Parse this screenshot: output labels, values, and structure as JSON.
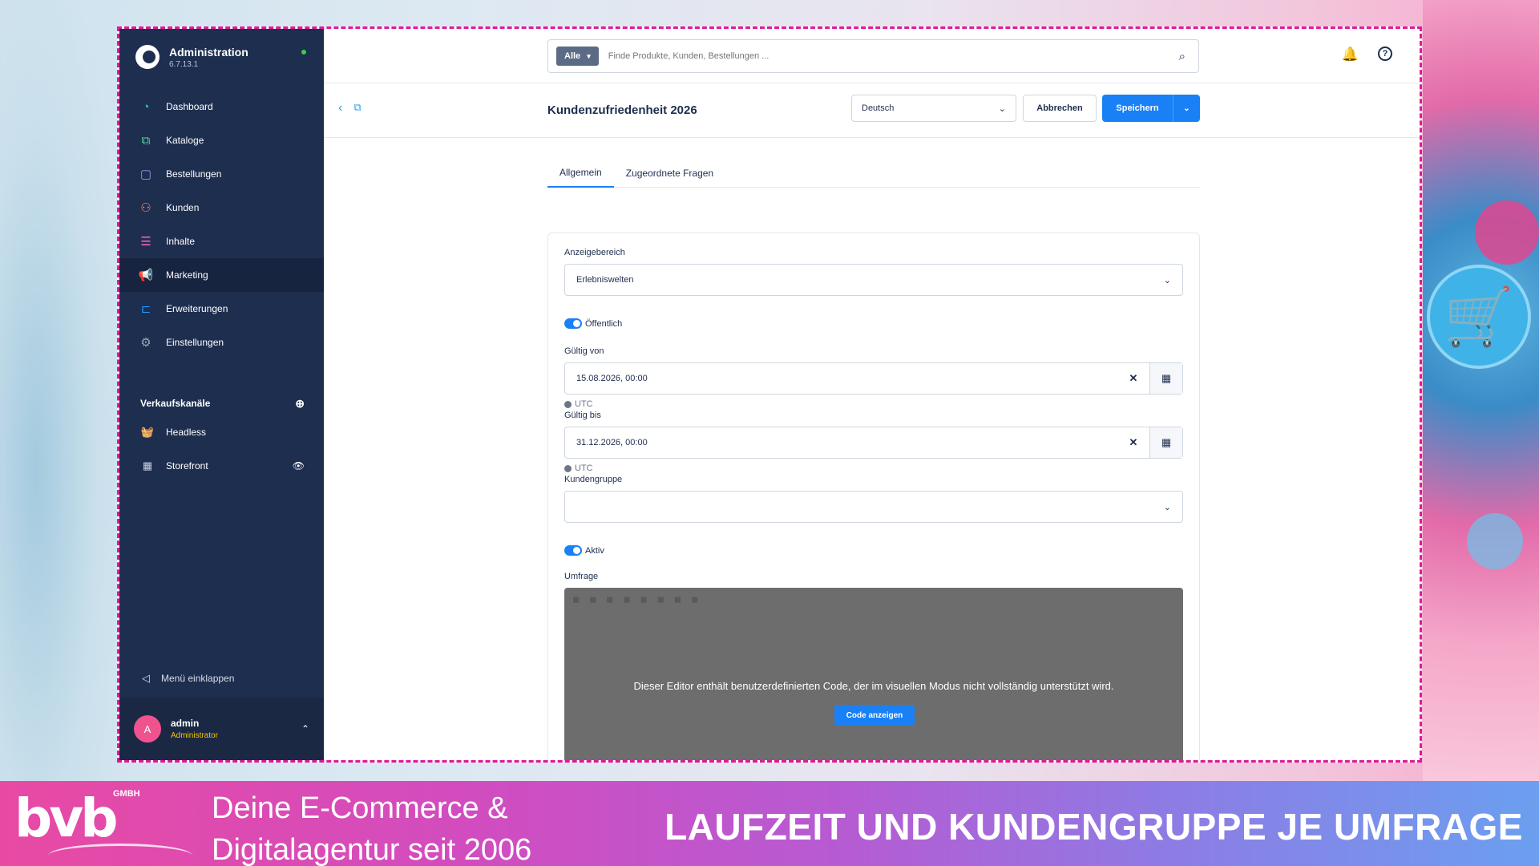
{
  "sidebar": {
    "brand_title": "Administration",
    "brand_version": "6.7.13.1",
    "items": [
      {
        "label": "Dashboard",
        "icon": "gauge-icon",
        "color": "#35c3b5"
      },
      {
        "label": "Kataloge",
        "icon": "catalog-icon",
        "color": "#57d9a3"
      },
      {
        "label": "Bestellungen",
        "icon": "bag-icon",
        "color": "#a092f0"
      },
      {
        "label": "Kunden",
        "icon": "users-icon",
        "color": "#f88962"
      },
      {
        "label": "Inhalte",
        "icon": "content-icon",
        "color": "#ff68b4"
      },
      {
        "label": "Marketing",
        "icon": "megaphone-icon",
        "color": "#ffd700"
      },
      {
        "label": "Erweiterungen",
        "icon": "plug-icon",
        "color": "#189eff"
      },
      {
        "label": "Einstellungen",
        "icon": "gear-icon",
        "color": "#9aa8b5"
      }
    ],
    "sales_channels_title": "Verkaufskanäle",
    "sales_channels": [
      {
        "label": "Headless",
        "icon": "basket-icon"
      },
      {
        "label": "Storefront",
        "icon": "storefront-icon"
      }
    ],
    "collapse_label": "Menü einklappen",
    "user": {
      "initial": "A",
      "name": "admin",
      "role": "Administrator"
    }
  },
  "topbar": {
    "search_scope": "Alle",
    "search_placeholder": "Finde Produkte, Kunden, Bestellungen ..."
  },
  "smartbar": {
    "title": "Kundenzufriedenheit 2026",
    "language": "Deutsch",
    "cancel_label": "Abbrechen",
    "save_label": "Speichern"
  },
  "tabs": [
    "Allgemein",
    "Zugeordnete Fragen"
  ],
  "form": {
    "display_area_label": "Anzeigebereich",
    "display_area_value": "Erlebniswelten",
    "public_label": "Öffentlich",
    "valid_from_label": "Gültig von",
    "valid_from_value": "15.08.2026, 00:00",
    "valid_to_label": "Gültig bis",
    "valid_to_value": "31.12.2026, 00:00",
    "timezone": "UTC",
    "customer_group_label": "Kundengruppe",
    "customer_group_value": "",
    "active_label": "Aktiv",
    "survey_label": "Umfrage",
    "editor_message": "Dieser Editor enthält benutzerdefinierten Code, der im visuellen Modus nicht vollständig unterstützt wird.",
    "show_code_label": "Code anzeigen"
  },
  "banner": {
    "logo_text": "bvb",
    "logo_suffix": "GMBH",
    "tagline_line1": "Deine E-Commerce &",
    "tagline_line2": "Digitalagentur seit 2006",
    "headline": "LAUFZEIT UND KUNDENGRUPPE JE UMFRAGE"
  },
  "colors": {
    "sidebar_bg": "#1e2e4f",
    "accent_blue": "#1a80f6",
    "frame_dash": "#e0189a",
    "status_online": "#37d046"
  }
}
